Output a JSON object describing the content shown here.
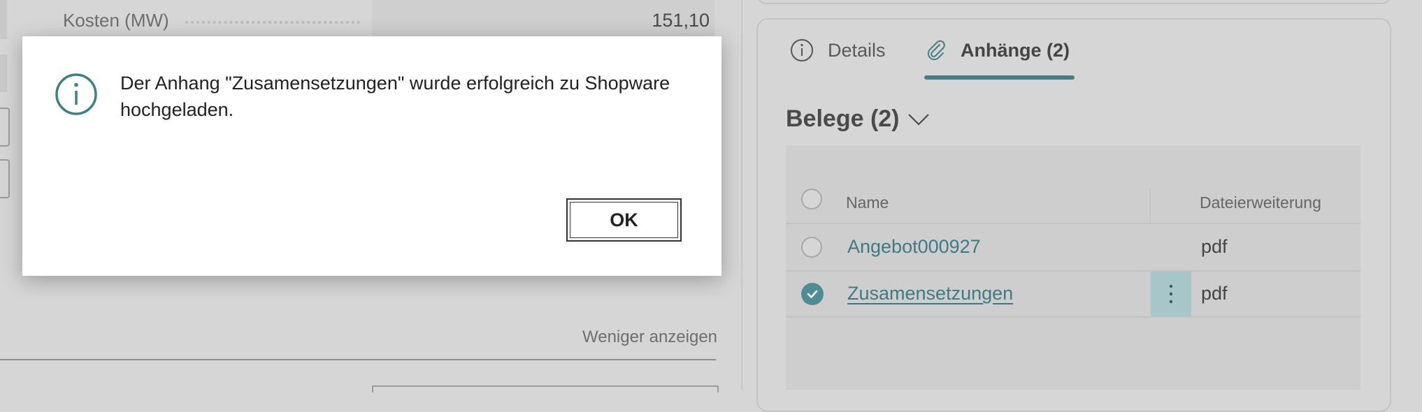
{
  "background_form": {
    "cost_label": "Kosten (MW)",
    "cost_value": "151,10",
    "show_less_link": "Weniger anzeigen"
  },
  "factbox": {
    "tabs": [
      {
        "label": "Details",
        "icon": "info-circle-icon",
        "active": false
      },
      {
        "label": "Anhänge (2)",
        "icon": "paperclip-icon",
        "active": true
      }
    ],
    "section_title": "Belege (2)",
    "columns": {
      "name": "Name",
      "extension": "Dateierweiterung"
    },
    "rows": [
      {
        "name": "Angebot000927",
        "extension": "pdf",
        "selected": false
      },
      {
        "name": "Zusamensetzungen",
        "extension": "pdf",
        "selected": true
      }
    ]
  },
  "dialog": {
    "icon": "info-circle-icon",
    "message": "Der Anhang \"Zusamensetzungen\" wurde erfolgreich zu Shopware hochgeladen.",
    "ok_label": "OK"
  },
  "colors": {
    "accent": "#477f87",
    "link": "#3f7a83",
    "dim_background": "#d6d6d6",
    "dialog_background": "#ffffff"
  }
}
